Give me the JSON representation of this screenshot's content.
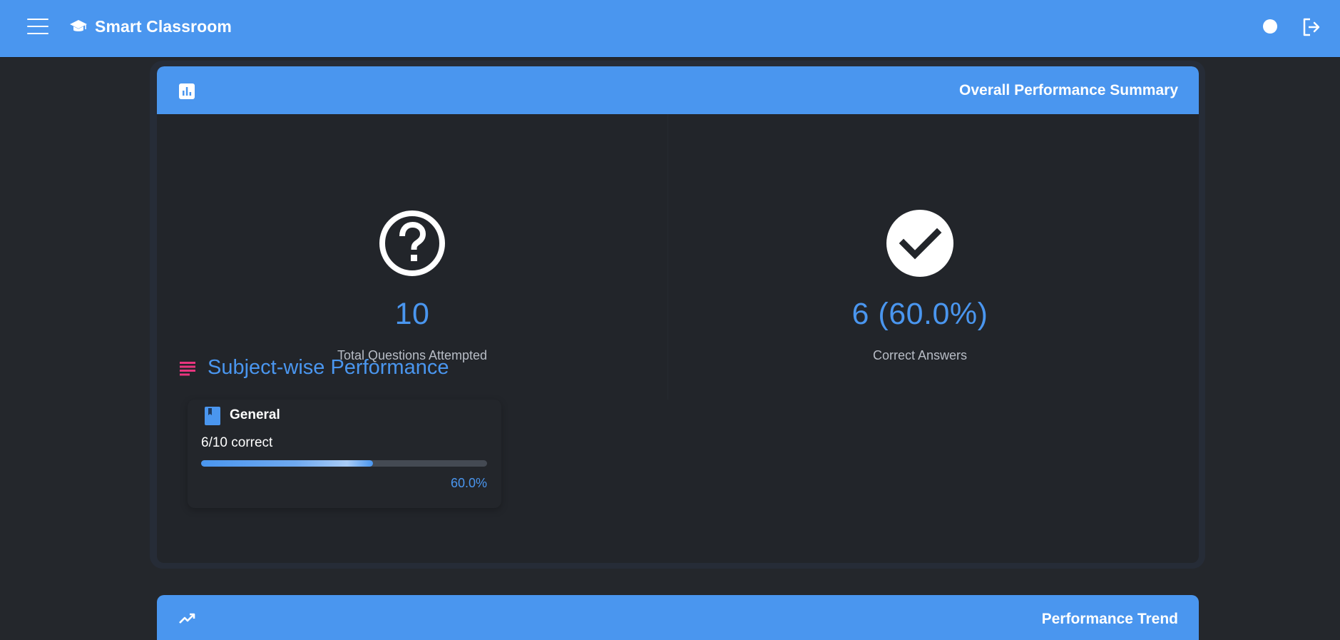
{
  "app": {
    "title": "Smart Classroom",
    "brand_icon": "graduation-cap-icon",
    "menu_icon": "hamburger-menu-icon",
    "theme_icon": "theme-toggle-icon",
    "logout_icon": "logout-icon"
  },
  "summary": {
    "title": "Overall Performance Summary",
    "header_icon": "bar-chart-icon",
    "stats": [
      {
        "icon": "question-circle-icon",
        "value": "10",
        "label": "Total Questions Attempted"
      },
      {
        "icon": "check-circle-icon",
        "value": "6 (60.0%)",
        "label": "Correct Answers"
      }
    ]
  },
  "subjects_section": {
    "title": "Subject-wise Performance",
    "icon": "list-icon",
    "subjects": [
      {
        "icon": "book-icon",
        "name": "General",
        "score": "6/10 correct",
        "progress": 0.6,
        "percent_label": "60.0%"
      }
    ]
  },
  "trend": {
    "title": "Performance Trend",
    "header_icon": "trending-up-icon"
  },
  "colors": {
    "primary": "#4a96ef",
    "background": "#24272c",
    "card": "#22252a",
    "accent_pink": "#e8357e"
  }
}
